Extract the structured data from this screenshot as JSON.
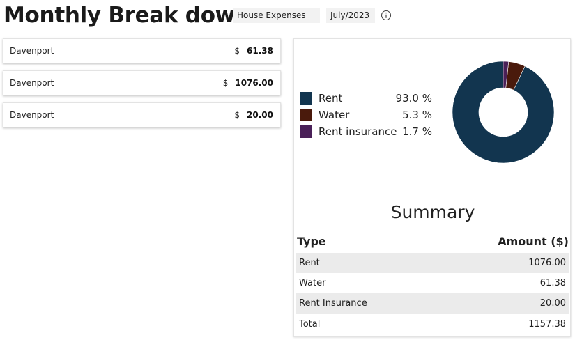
{
  "header": {
    "title": "Monthly Break down",
    "category": "House Expenses",
    "month": "July/2023",
    "info_icon": "info-icon"
  },
  "expense_cards": [
    {
      "name": "Davenport",
      "currency": "$",
      "amount": "61.38"
    },
    {
      "name": "Davenport",
      "currency": "$",
      "amount": "1076.00"
    },
    {
      "name": "Davenport",
      "currency": "$",
      "amount": "20.00"
    }
  ],
  "chart_data": {
    "type": "pie",
    "style": "donut",
    "legend_position": "left",
    "slices": [
      {
        "label": "Rent",
        "percent_label": "93.0 %",
        "value": 93.0,
        "color": "#12354f"
      },
      {
        "label": "Water",
        "percent_label": "5.3 %",
        "value": 5.3,
        "color": "#4a1a0c"
      },
      {
        "label": "Rent insurance",
        "percent_label": "1.7 %",
        "value": 1.7,
        "color": "#4a2058"
      }
    ]
  },
  "summary": {
    "title": "Summary",
    "columns": {
      "type": "Type",
      "amount": "Amount ($)"
    },
    "rows": [
      {
        "type": "Rent",
        "amount": "1076.00"
      },
      {
        "type": "Water",
        "amount": "61.38"
      },
      {
        "type": "Rent Insurance",
        "amount": "20.00"
      }
    ],
    "total": {
      "label": "Total",
      "amount": "1157.38"
    }
  }
}
